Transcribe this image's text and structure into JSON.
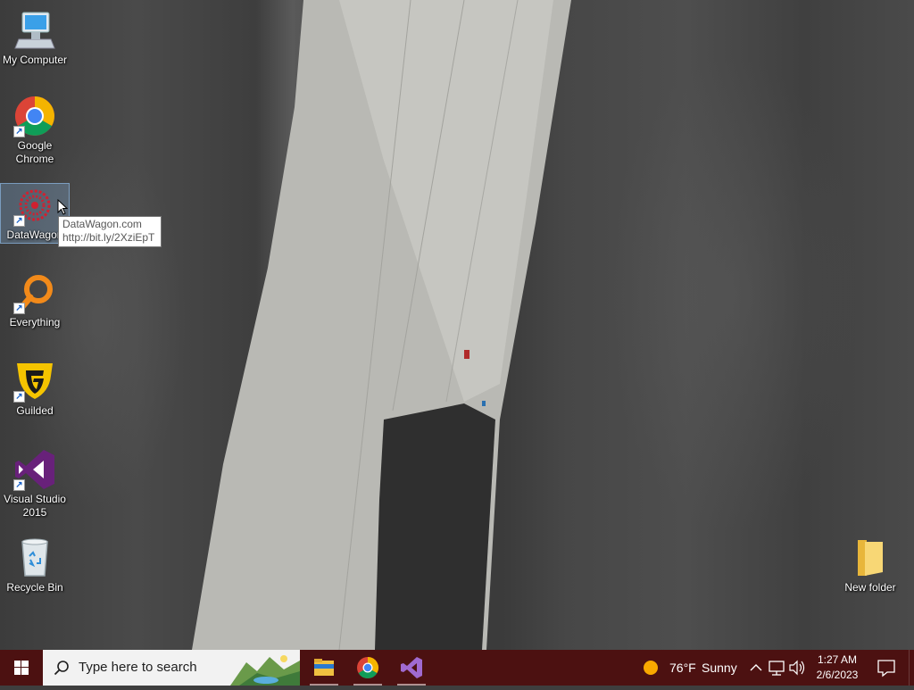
{
  "desktop": {
    "icons": [
      {
        "label": "My Computer",
        "icon": "computer-icon"
      },
      {
        "label": "Google Chrome",
        "icon": "chrome-icon"
      },
      {
        "label": "DataWagon",
        "icon": "datawagon-icon"
      },
      {
        "label": "Everything",
        "icon": "everything-search-icon"
      },
      {
        "label": "Guilded",
        "icon": "guilded-icon"
      },
      {
        "label": "Visual Studio 2015",
        "icon": "visual-studio-icon"
      },
      {
        "label": "Recycle Bin",
        "icon": "recycle-bin-icon"
      },
      {
        "label": "New folder",
        "icon": "folder-icon"
      }
    ],
    "tooltip": {
      "line1": "DataWagon.com",
      "line2": "http://bit.ly/2XziEpT"
    }
  },
  "taskbar": {
    "search_placeholder": "Type here to search",
    "pinned_apps": [
      "file-explorer-icon",
      "chrome-icon",
      "visual-studio-icon"
    ],
    "weather": {
      "temperature": "76°F",
      "condition": "Sunny"
    },
    "clock": {
      "time": "1:27 AM",
      "date": "2/6/2023"
    }
  },
  "colors": {
    "taskbar": "#4c1111",
    "search_box": "#f2f2f2"
  }
}
